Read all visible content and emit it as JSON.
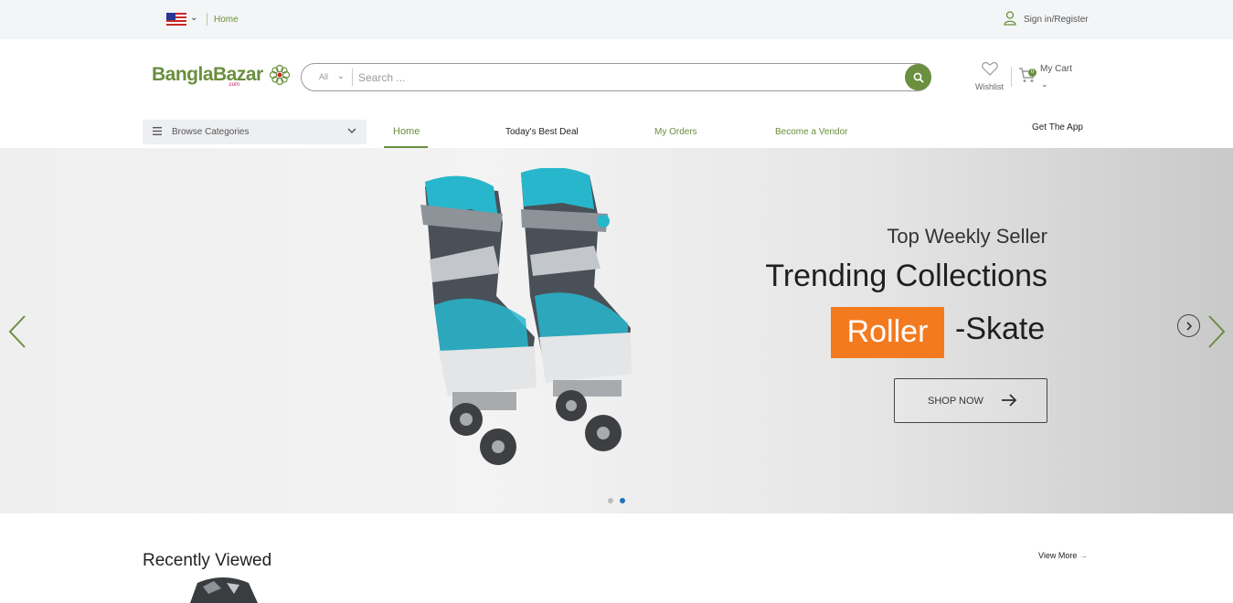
{
  "topbar": {
    "flag_icon": "us-flag-icon",
    "home_link": "Home",
    "signin_label": "Sign in/Register"
  },
  "header": {
    "logo_text": "BanglaBazar",
    "logo_suffix": ".com",
    "search": {
      "category": "All",
      "placeholder": "Search ..."
    },
    "wishlist_label": "Wishlist",
    "cart_label": "My Cart",
    "cart_count": "0"
  },
  "nav": {
    "browse_label": "Browse Categories",
    "items": [
      "Home",
      "Today's Best Deal",
      "My Orders",
      "Become a Vendor"
    ],
    "get_app": "Get The App"
  },
  "banner": {
    "subtitle": "Top Weekly Seller",
    "title": "Trending Collections",
    "tag": "Roller",
    "tag_suffix": "-Skate",
    "cta": "SHOP NOW",
    "active_slide": 2,
    "total_slides": 2
  },
  "recent": {
    "title": "Recently Viewed",
    "view_more": "View More"
  },
  "colors": {
    "brand_green": "#6a8f3e",
    "accent_orange": "#f47a1f",
    "dot_active": "#1e73be"
  }
}
